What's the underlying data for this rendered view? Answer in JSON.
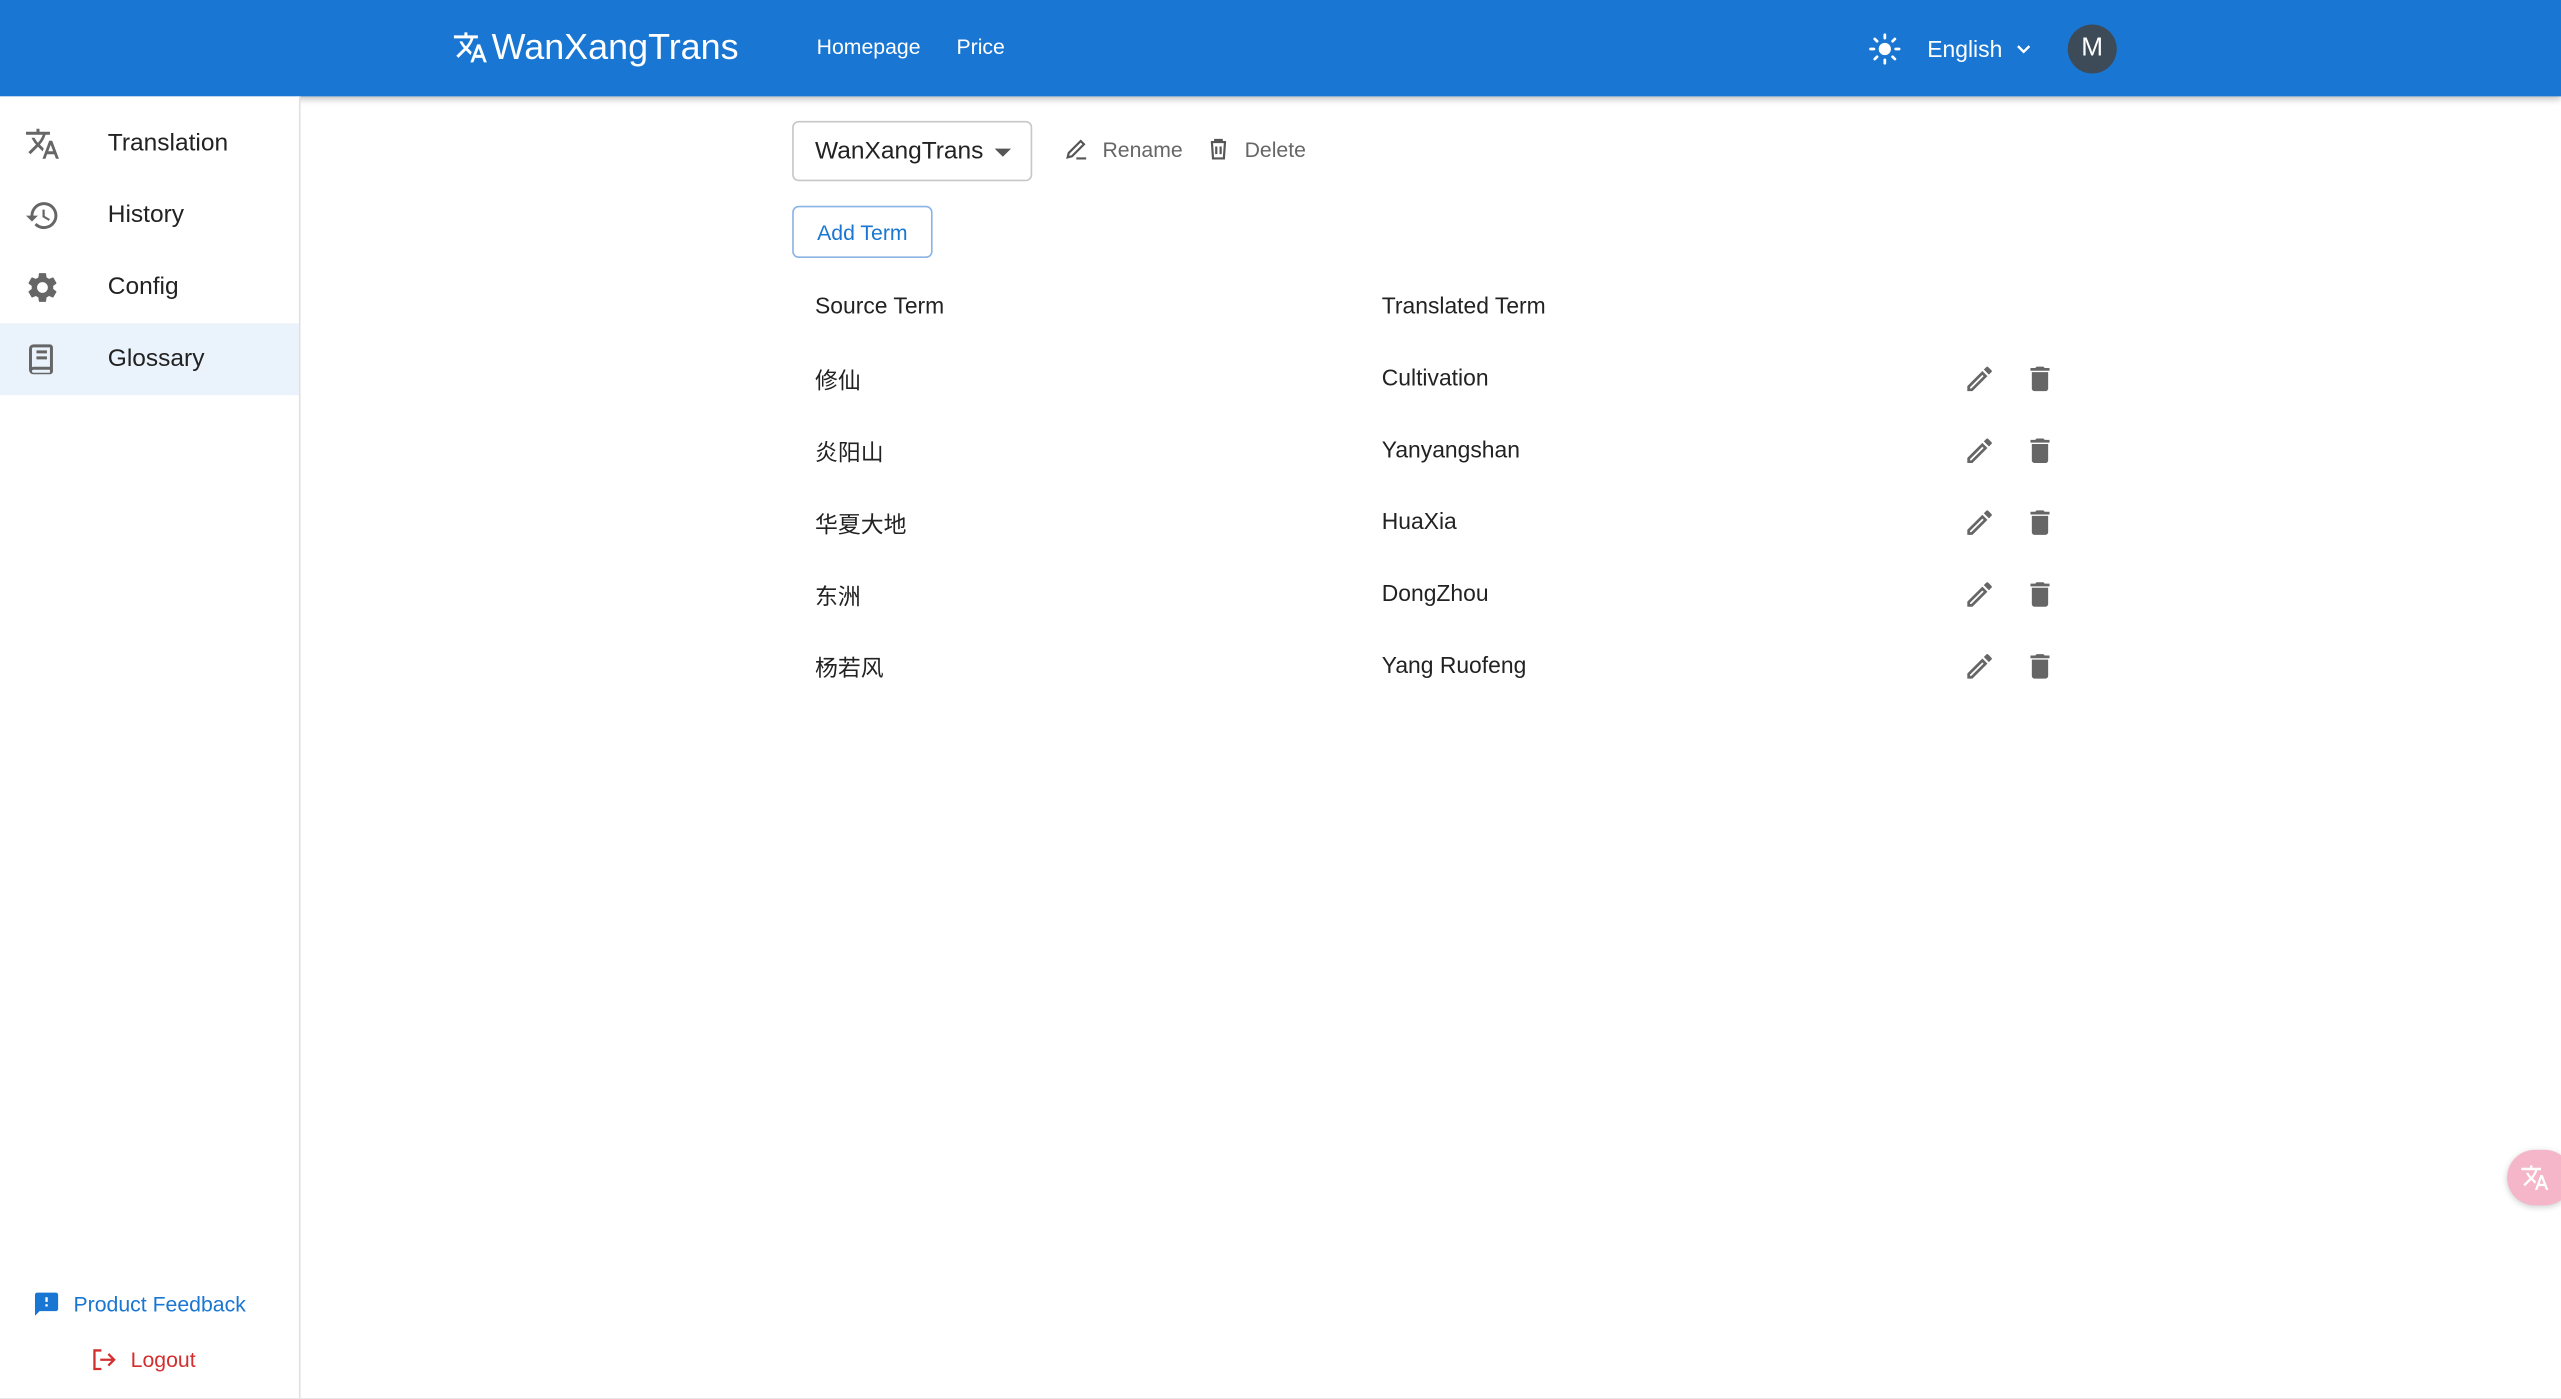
{
  "header": {
    "brand": "WanXangTrans",
    "nav": [
      "Homepage",
      "Price"
    ],
    "language": "English",
    "avatar_initial": "M",
    "color": "#1976d2"
  },
  "sidebar": {
    "items": [
      {
        "label": "Translation",
        "icon": "translate-icon"
      },
      {
        "label": "History",
        "icon": "history-icon"
      },
      {
        "label": "Config",
        "icon": "gear-icon"
      },
      {
        "label": "Glossary",
        "icon": "glossary-book-icon",
        "active": true
      }
    ],
    "feedback": "Product Feedback",
    "logout": "Logout"
  },
  "glossary": {
    "selected": "WanXangTrans",
    "rename": "Rename",
    "delete": "Delete",
    "add_term": "Add Term",
    "columns": [
      "Source Term",
      "Translated Term"
    ],
    "rows": [
      {
        "source": "修仙",
        "translated": "Cultivation"
      },
      {
        "source": "炎阳山",
        "translated": "Yanyangshan"
      },
      {
        "source": "华夏大地",
        "translated": "HuaXia"
      },
      {
        "source": "东洲",
        "translated": "DongZhou"
      },
      {
        "source": "杨若风",
        "translated": "Yang Ruofeng"
      }
    ]
  }
}
